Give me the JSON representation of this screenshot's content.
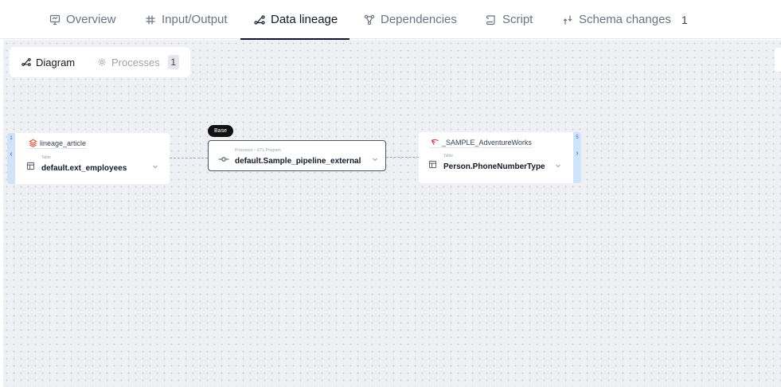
{
  "tabs": [
    {
      "label": "Overview",
      "icon": "monitor-icon"
    },
    {
      "label": "Input/Output",
      "icon": "hash-icon"
    },
    {
      "label": "Data lineage",
      "icon": "lineage-icon",
      "active": true
    },
    {
      "label": "Dependencies",
      "icon": "dependencies-icon"
    },
    {
      "label": "Script",
      "icon": "script-icon"
    },
    {
      "label": "Schema changes",
      "icon": "schema-changes-icon",
      "count": "1"
    }
  ],
  "subtabs": {
    "diagram": "Diagram",
    "processes": "Processes",
    "processes_count": "1"
  },
  "nodes": {
    "left": {
      "rail_number": "1",
      "rail_arrow": "‹",
      "source": "lineage_article",
      "type": "Table",
      "name": "default.ext_employees"
    },
    "processor": {
      "badge": "Base",
      "type": "Processor – ETL Program",
      "name": "default.Sample_pipeline_external"
    },
    "right": {
      "rail_number": "5",
      "rail_arrow": "›",
      "source": "_SAMPLE_AdventureWorks",
      "type": "Table",
      "name": "Person.PhoneNumberType"
    }
  },
  "colors": {
    "canvas": "#eef0f3",
    "rail": "#cfe3fb",
    "accent": "#2563eb",
    "source_left": "#e0533d",
    "source_right": "#d9363e"
  }
}
